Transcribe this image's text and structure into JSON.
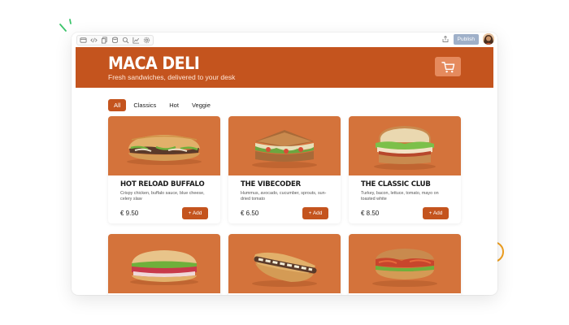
{
  "toolbar": {
    "tools": [
      "browser-icon",
      "code-icon",
      "pages-icon",
      "database-icon",
      "search-icon",
      "analytics-icon",
      "settings-icon"
    ],
    "publish_label": "Publish"
  },
  "header": {
    "brand": "MACA DELI",
    "tagline": "Fresh sandwiches, delivered to your desk",
    "cart_icon": "cart-icon"
  },
  "filters": [
    "All",
    "Classics",
    "Hot",
    "Veggie"
  ],
  "active_filter": "All",
  "products": [
    {
      "name": "HOT RELOAD BUFFALO",
      "description": "Crispy chicken, buffalo sauce, blue cheese, celery slaw",
      "price": "€ 9.50",
      "add_label": "+ Add"
    },
    {
      "name": "THE VIBECODER",
      "description": "Hummus, avocado, cucumber, sprouts, sun-dried tomato",
      "price": "€ 6.50",
      "add_label": "+ Add"
    },
    {
      "name": "THE CLASSIC CLUB",
      "description": "Turkey, bacon, lettuce, tomato, mayo on toasted white",
      "price": "€ 8.50",
      "add_label": "+ Add"
    }
  ],
  "colors": {
    "brand": "#c4541e",
    "card_bg": "#d4733b",
    "accent_ring": "#f0a020",
    "publish": "#9fb0c9"
  }
}
